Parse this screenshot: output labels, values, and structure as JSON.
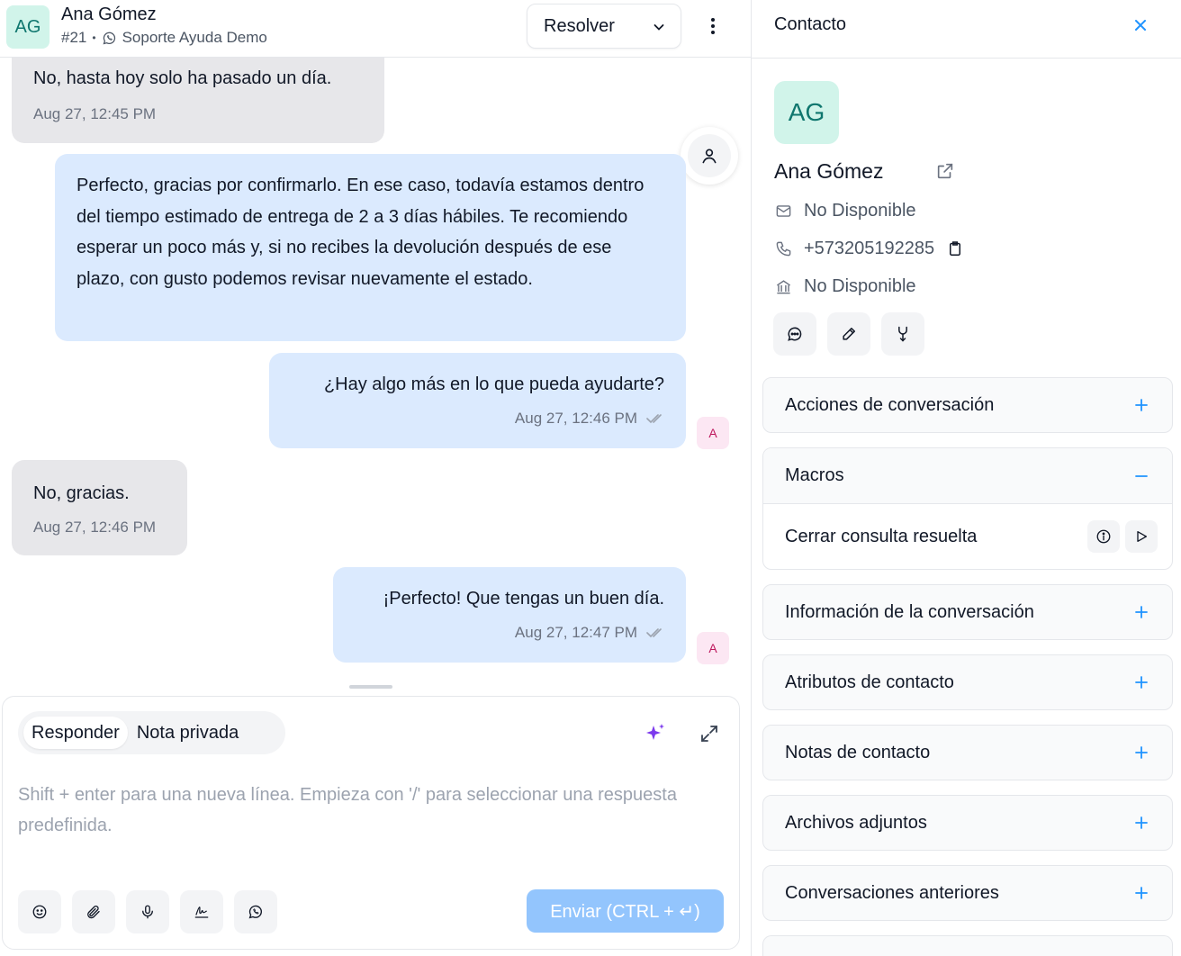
{
  "header": {
    "avatar_initials": "AG",
    "contact_name": "Ana Gómez",
    "conversation_id": "#21",
    "inbox_name": "Soporte Ayuda Demo",
    "resolve_label": "Resolver"
  },
  "messages": [
    {
      "direction": "incoming",
      "text": "No, hasta hoy solo ha pasado un día.",
      "time": "Aug 27, 12:45 PM"
    },
    {
      "direction": "outgoing",
      "text": "Perfecto, gracias por confirmarlo. En ese caso, todavía estamos dentro del tiempo estimado de entrega de 2 a 3 días hábiles. Te recomiendo esperar un poco más y, si no recibes la devolución después de ese plazo, con gusto podemos revisar nuevamente el estado.",
      "time": ""
    },
    {
      "direction": "outgoing",
      "text": "¿Hay algo más en lo que pueda ayudarte?",
      "time": "Aug 27, 12:46 PM",
      "agent_initial": "A"
    },
    {
      "direction": "incoming",
      "text": "No, gracias.",
      "time": "Aug 27, 12:46 PM"
    },
    {
      "direction": "outgoing",
      "text": "¡Perfecto! Que tengas un buen día.",
      "time": "Aug 27, 12:47 PM",
      "agent_initial": "A"
    }
  ],
  "composer": {
    "tab_reply": "Responder",
    "tab_private_note": "Nota privada",
    "active_tab": "Responder",
    "placeholder": "Shift + enter para una nueva línea. Empieza con '/' para seleccionar una respuesta predefinida.",
    "value": "",
    "send_label": "Enviar (CTRL + ↵)",
    "tools": [
      "emoji-icon",
      "paperclip-icon",
      "microphone-icon",
      "signature-icon",
      "whatsapp-icon"
    ]
  },
  "contact_panel": {
    "title": "Contacto",
    "avatar_initials": "AG",
    "name": "Ana Gómez",
    "email": "No Disponible",
    "phone": "+573205192285",
    "company": "No Disponible",
    "actions": [
      "message-icon",
      "edit-icon",
      "merge-icon"
    ],
    "sections": [
      {
        "title": "Acciones de conversación",
        "expanded": false
      },
      {
        "title": "Macros",
        "expanded": true
      },
      {
        "title": "Información de la conversación",
        "expanded": false
      },
      {
        "title": "Atributos de contacto",
        "expanded": false
      },
      {
        "title": "Notas de contacto",
        "expanded": false
      },
      {
        "title": "Archivos adjuntos",
        "expanded": false
      },
      {
        "title": "Conversaciones anteriores",
        "expanded": false
      }
    ],
    "macros": [
      {
        "name": "Cerrar consulta resuelta"
      }
    ]
  },
  "colors": {
    "accent": "#1f93ff",
    "outgoing_bubble": "#dbeafe",
    "incoming_bubble": "#e7e7ea",
    "avatar_bg": "#d1f4ea",
    "agent_badge_bg": "#fce7f3",
    "send_button": "#93c5fd"
  }
}
